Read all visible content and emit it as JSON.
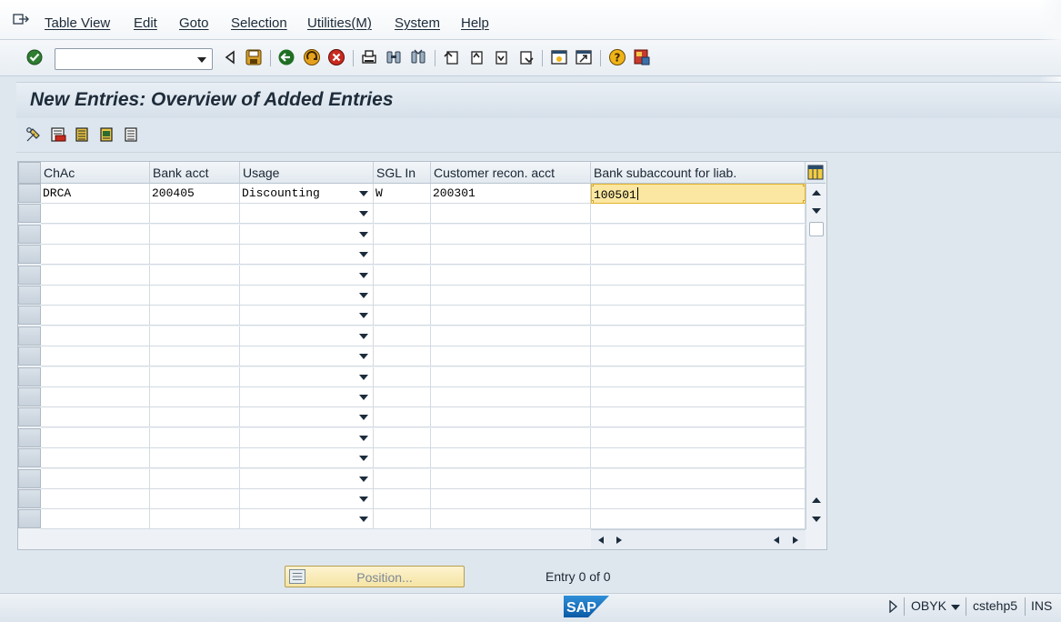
{
  "menubar": {
    "items": [
      "Table View",
      "Edit",
      "Goto",
      "Selection",
      "Utilities(M)",
      "System",
      "Help"
    ]
  },
  "toolbar": {
    "command_field_value": ""
  },
  "title": "New Entries: Overview of Added Entries",
  "table": {
    "columns": [
      "ChAc",
      "Bank acct",
      "Usage",
      "SGL In",
      "Customer recon. acct",
      "Bank subaccount for liab."
    ],
    "rows": [
      [
        "DRCA",
        "200405",
        "Discounting",
        "W",
        "200301",
        "100501"
      ]
    ],
    "empty_rows": 16
  },
  "position_button_label": "Position...",
  "entry_count": "Entry 0 of 0",
  "statusbar": {
    "logo": "SAP",
    "transaction": "OBYK",
    "system": "cstehp5",
    "mode": "INS"
  }
}
